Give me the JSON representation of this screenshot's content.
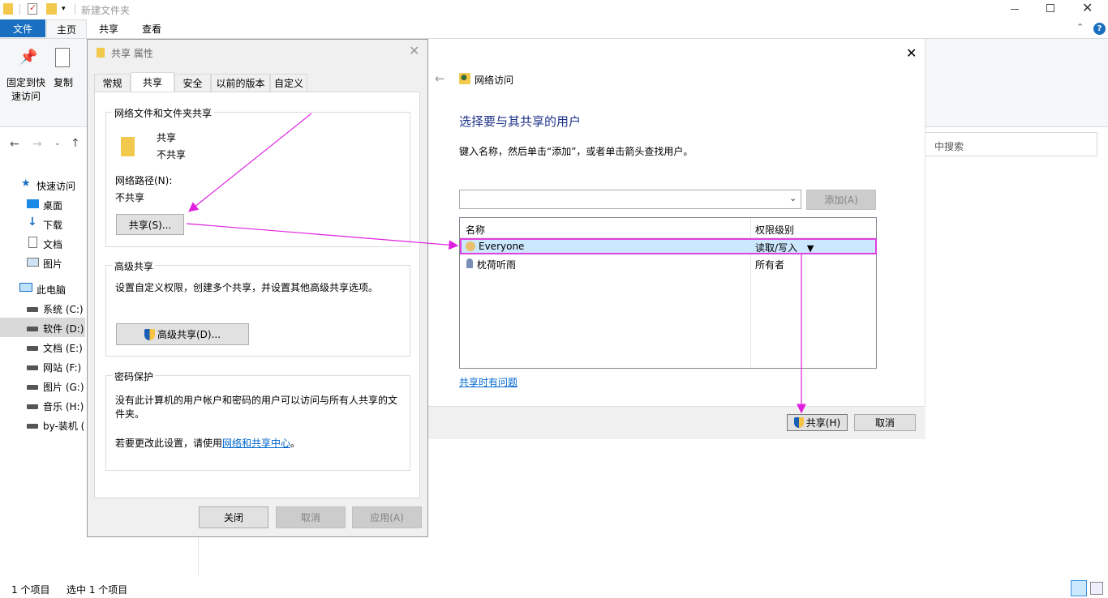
{
  "explorer": {
    "title": "新建文件夹",
    "ribbon_tabs": [
      "文件",
      "主页",
      "共享",
      "查看"
    ],
    "ribbon_buttons": {
      "pin_label_1": "固定到快",
      "pin_label_2": "速访问",
      "copy_label": "复制"
    },
    "search_placeholder": "中搜索",
    "nav": {
      "quick_access": "快速访问",
      "desktop": "桌面",
      "downloads": "下载",
      "documents": "文档",
      "pictures": "图片",
      "this_pc": "此电脑",
      "drives": [
        "系统 (C:)",
        "软件 (D:)",
        "文档 (E:)",
        "网站 (F:)",
        "图片 (G:)",
        "音乐 (H:)",
        "by-装机 (I"
      ]
    },
    "status": {
      "items": "1 个项目",
      "selected": "选中 1 个项目"
    }
  },
  "properties": {
    "title": "共享 属性",
    "tabs": [
      "常规",
      "共享",
      "安全",
      "以前的版本",
      "自定义"
    ],
    "network_group": "网络文件和文件夹共享",
    "folder_name": "共享",
    "folder_status": "不共享",
    "network_path_label": "网络路径(N):",
    "network_path_value": "不共享",
    "share_button": "共享(S)...",
    "advanced_group": "高级共享",
    "advanced_desc": "设置自定义权限，创建多个共享，并设置其他高级共享选项。",
    "advanced_button": "高级共享(D)...",
    "password_group": "密码保护",
    "password_desc": "没有此计算机的用户帐户和密码的用户可以访问与所有人共享的文件夹。",
    "password_change_prefix": "若要更改此设置，请使用",
    "password_link": "网络和共享中心",
    "password_change_suffix": "。",
    "close_button": "关闭",
    "cancel_button": "取消",
    "apply_button": "应用(A)"
  },
  "network": {
    "title": "网络访问",
    "heading": "选择要与其共享的用户",
    "instruction": "键入名称，然后单击“添加”，或者单击箭头查找用户。",
    "add_button": "添加(A)",
    "columns": [
      "名称",
      "权限级别"
    ],
    "rows": [
      {
        "name": "Everyone",
        "level": "读取/写入"
      },
      {
        "name": "枕荷听雨",
        "level": "所有者"
      }
    ],
    "trouble_link": "共享时有问题",
    "share_button": "共享(H)",
    "cancel_button": "取消"
  },
  "colors": {
    "accent": "#0063b1",
    "highlight": "#cce8ff",
    "annotation": "#ff00ff",
    "link": "#0066cc"
  }
}
